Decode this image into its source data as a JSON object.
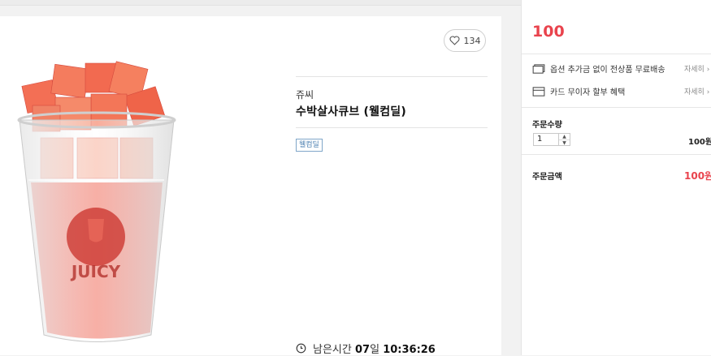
{
  "product": {
    "like_count": "134",
    "brand": "쥬씨",
    "name": "수박살사큐브 (웰컴딜)",
    "tag": "웰컴딜",
    "image_logo_text": "JUICY"
  },
  "timer": {
    "label": "남은시간",
    "days": "07",
    "days_unit": "일",
    "time": "10:36:26"
  },
  "side": {
    "price": "100",
    "benefits": [
      {
        "label": "옵션 추가금 없이 전상품 무료배송",
        "detail": "자세히 ›",
        "icon": "delivery-card-icon"
      },
      {
        "label": "카드 무이자 할부 혜택",
        "detail": "자세히 ›",
        "icon": "credit-card-icon"
      }
    ],
    "quantity_label": "주문수량",
    "quantity_value": "1",
    "row_price": "100원",
    "total_label": "주문금액",
    "total_price": "100원"
  },
  "colors": {
    "accent": "#e9434d",
    "tag": "#4b7fb0"
  }
}
